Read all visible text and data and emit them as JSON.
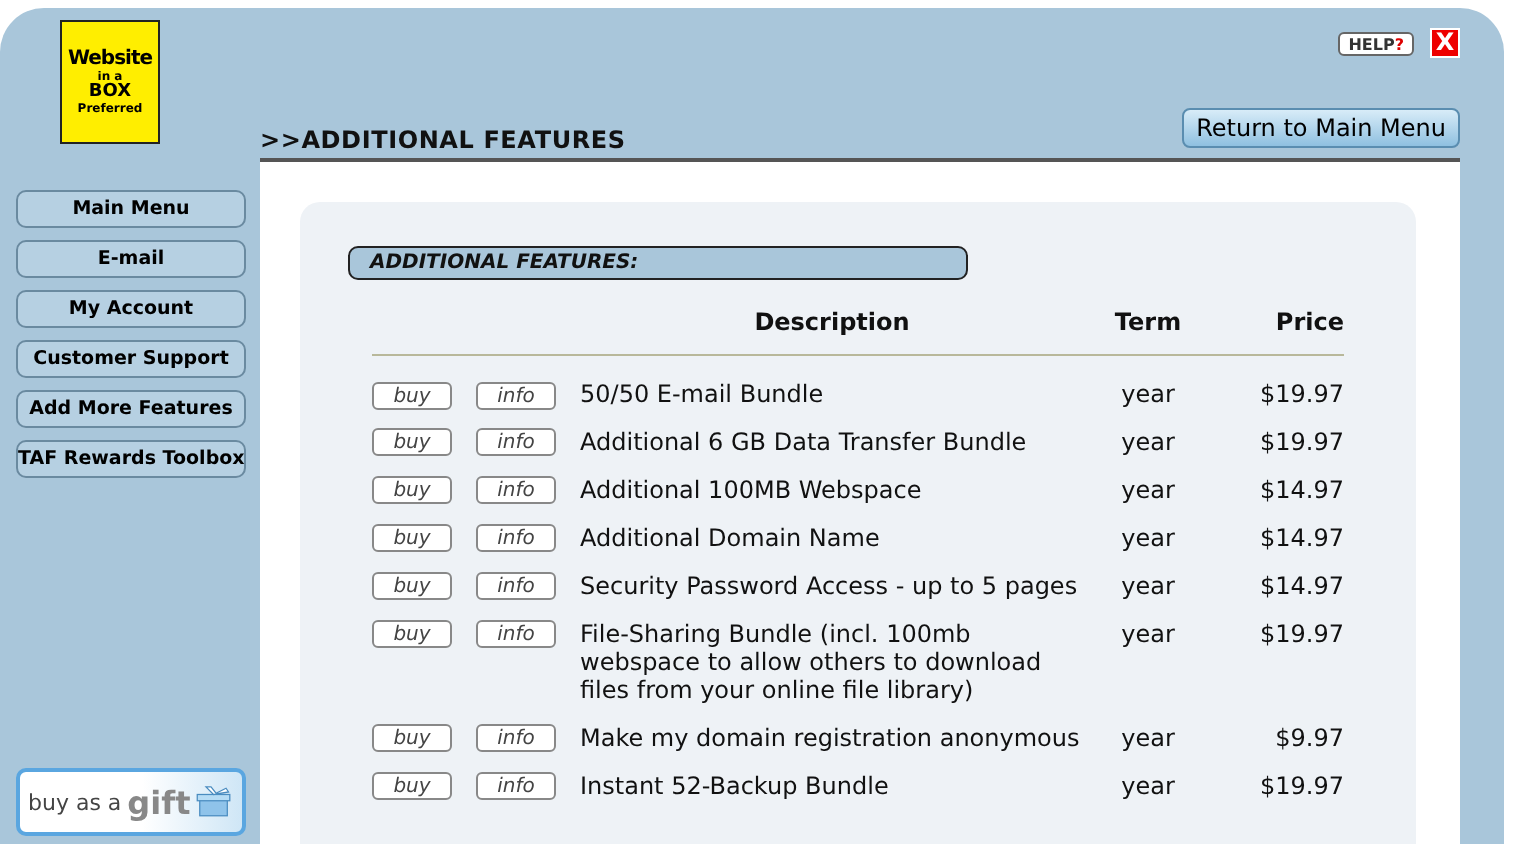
{
  "logo": {
    "line_1": "Website",
    "line_2": "in a",
    "line_3": "BOX",
    "line_4": "Preferred"
  },
  "help": "HELP",
  "help_mark": "?",
  "close": "X",
  "page_title": ">>ADDITIONAL FEATURES",
  "return_button": "Return to Main Menu",
  "sidebar": {
    "items": [
      {
        "label": "Main Menu"
      },
      {
        "label": "E-mail"
      },
      {
        "label": "My Account"
      },
      {
        "label": "Customer Support"
      },
      {
        "label": "Add More Features"
      },
      {
        "label": "TAF Rewards Toolbox"
      }
    ],
    "gift": {
      "text": "buy as a",
      "big": "gift"
    }
  },
  "section_title": "ADDITIONAL FEATURES:",
  "table": {
    "columns": [
      "Description",
      "Term",
      "Price"
    ],
    "rows": [
      {
        "buy": "buy",
        "info": "info",
        "description": "50/50 E-mail Bundle",
        "term": "year",
        "price": "$19.97"
      },
      {
        "buy": "buy",
        "info": "info",
        "description": "Additional 6 GB Data Transfer Bundle",
        "term": "year",
        "price": "$19.97"
      },
      {
        "buy": "buy",
        "info": "info",
        "description": "Additional 100MB Webspace",
        "term": "year",
        "price": "$14.97"
      },
      {
        "buy": "buy",
        "info": "info",
        "description": "Additional Domain Name",
        "term": "year",
        "price": "$14.97"
      },
      {
        "buy": "buy",
        "info": "info",
        "description": "Security Password Access - up to 5 pages",
        "term": "year",
        "price": "$14.97"
      },
      {
        "buy": "buy",
        "info": "info",
        "description": "File-Sharing Bundle (incl. 100mb webspace to allow others to download files from your online file library)",
        "term": "year",
        "price": "$19.97"
      },
      {
        "buy": "buy",
        "info": "info",
        "description": "Make my domain registration anonymous",
        "term": "year",
        "price": "$9.97"
      },
      {
        "buy": "buy",
        "info": "info",
        "description": "Instant 52-Backup Bundle",
        "term": "year",
        "price": "$19.97"
      }
    ]
  }
}
